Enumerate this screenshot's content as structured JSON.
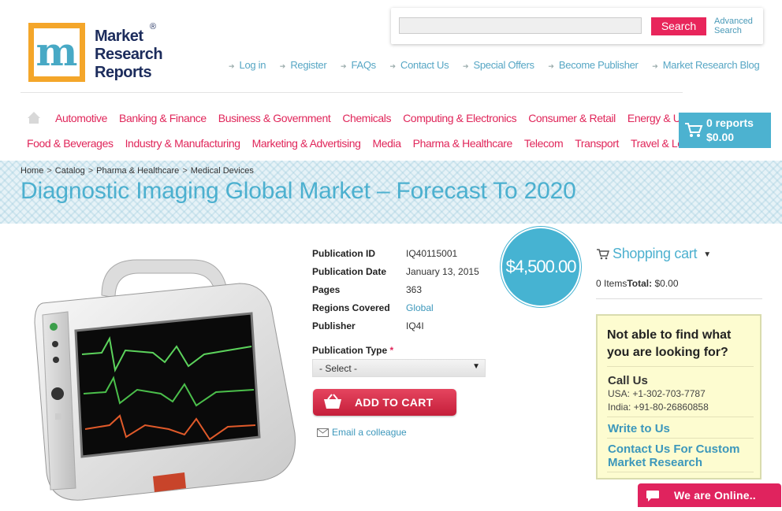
{
  "logo": {
    "mark": "m",
    "lines": [
      "Market",
      "Research",
      "Reports"
    ],
    "registered": "®"
  },
  "search": {
    "placeholder": "",
    "button_label": "Search",
    "advanced_line1": "Advanced",
    "advanced_line2": "Search"
  },
  "top_links": [
    "Log in",
    "Register",
    "FAQs",
    "Contact Us",
    "Special Offers",
    "Become Publisher",
    "Market Research Blog"
  ],
  "categories_row1": [
    "Automotive",
    "Banking & Finance",
    "Business & Government",
    "Chemicals",
    "Computing & Electronics",
    "Consumer & Retail",
    "Energy & Utilities"
  ],
  "categories_row2": [
    "Food & Beverages",
    "Industry & Manufacturing",
    "Marketing & Advertising",
    "Media",
    "Pharma & Healthcare",
    "Telecom",
    "Transport",
    "Travel & Leisure"
  ],
  "cart": {
    "count": "0 reports",
    "total": "$0.00"
  },
  "breadcrumb": [
    "Home",
    "Catalog",
    "Pharma & Healthcare",
    "Medical Devices"
  ],
  "breadcrumb_sep": ">",
  "title": "Diagnostic Imaging Global Market – Forecast To 2020",
  "details": {
    "publication_id_label": "Publication ID",
    "publication_id": "IQ40115001",
    "publication_date_label": "Publication Date",
    "publication_date": "January 13, 2015",
    "pages_label": "Pages",
    "pages": "363",
    "regions_label": "Regions Covered",
    "regions": "Global",
    "publisher_label": "Publisher",
    "publisher": "IQ4I"
  },
  "price": "$4,500.00",
  "publication_type": {
    "label": "Publication Type",
    "required_mark": "*",
    "selected": "- Select -"
  },
  "add_to_cart_label": "ADD TO CART",
  "email_label": "Email a colleague",
  "sidebar": {
    "cart_title": "Shopping cart",
    "items_text": "0 Items",
    "total_label": "Total:",
    "total_value": " $0.00",
    "help_question": "Not able to find what you are looking for?",
    "call_us": "Call Us",
    "phone_usa": "USA: +1-302-703-7787",
    "phone_india": "India: +91-80-26860858",
    "write_to_us": "Write to Us",
    "custom_research": "Contact Us For Custom Market Research"
  },
  "chat_label": "We are Online..",
  "colors": {
    "accent_pink": "#e0265a",
    "accent_blue": "#4cb0cf",
    "logo_orange": "#f4a62a",
    "logo_navy": "#1c2c5c"
  },
  "icons": [
    "home-icon",
    "cart-icon",
    "basket-icon",
    "envelope-icon",
    "chat-bubble-icon",
    "chevron-down-icon"
  ]
}
